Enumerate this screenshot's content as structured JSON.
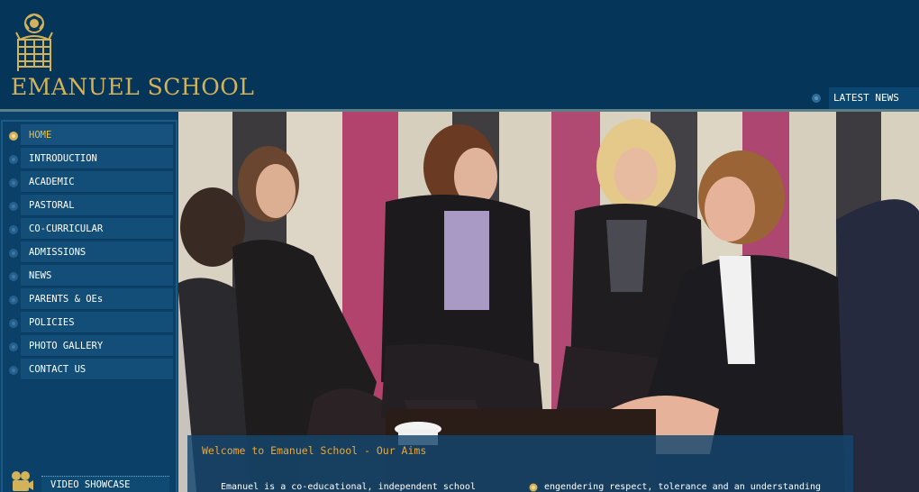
{
  "header": {
    "logo_text": "EMANUEL SCHOOL",
    "latest_news_label": "LATEST NEWS"
  },
  "nav": {
    "items": [
      {
        "label": "HOME",
        "active": true
      },
      {
        "label": "INTRODUCTION"
      },
      {
        "label": "ACADEMIC"
      },
      {
        "label": "PASTORAL"
      },
      {
        "label": "CO-CURRICULAR"
      },
      {
        "label": "ADMISSIONS"
      },
      {
        "label": "NEWS"
      },
      {
        "label": "PARENTS & OEs"
      },
      {
        "label": "POLICIES"
      },
      {
        "label": "PHOTO GALLERY"
      },
      {
        "label": "CONTACT US"
      }
    ]
  },
  "sidebar": {
    "video_showcase_label": "VIDEO SHOWCASE"
  },
  "welcome": {
    "title": "Welcome to Emanuel School - Our Aims",
    "text_col1": "Emanuel is a co-educational, independent school",
    "text_col2": "engendering respect, tolerance and an understanding"
  },
  "colors": {
    "header_bg": "#05365a",
    "logo_gold": "#d3b25a",
    "active_nav": "#f1c232",
    "welcome_title": "#e8a83a"
  },
  "icons": {
    "crest": "school-crest-icon",
    "bullet": "rose-bullet-icon",
    "camera": "film-camera-icon"
  }
}
